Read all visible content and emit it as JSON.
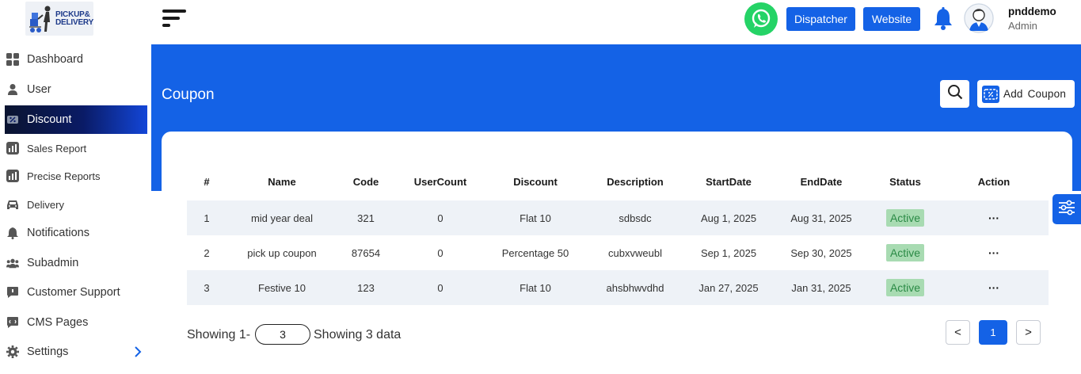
{
  "brand": {
    "logo_line1": "PICKUP&",
    "logo_line2": "DELIVERY"
  },
  "sidebar": {
    "items": [
      {
        "label": "Dashboard",
        "icon": "dashboard-grid-icon"
      },
      {
        "label": "User",
        "icon": "user-icon"
      },
      {
        "label": "Discount",
        "icon": "discount-ticket-icon",
        "active": true
      },
      {
        "label": "Sales Report",
        "icon": "chart-icon"
      },
      {
        "label": "Precise Reports",
        "icon": "chart-icon"
      },
      {
        "label": "Delivery",
        "icon": "car-icon"
      },
      {
        "label": "Notifications",
        "icon": "bell-icon"
      },
      {
        "label": "Subadmin",
        "icon": "group-icon"
      },
      {
        "label": "Customer Support",
        "icon": "chat-icon"
      },
      {
        "label": "CMS Pages",
        "icon": "chat-icon"
      },
      {
        "label": "Settings",
        "icon": "gear-icon",
        "has_submenu": true
      }
    ]
  },
  "topbar": {
    "dispatcher_label": "Dispatcher",
    "website_label": "Website",
    "user_name": "pnddemo",
    "user_role": "Admin"
  },
  "page": {
    "title": "Coupon",
    "add_label": "Add  Coupon"
  },
  "table": {
    "columns": [
      "#",
      "Name",
      "Code",
      "UserCount",
      "Discount",
      "Description",
      "StartDate",
      "EndDate",
      "Status",
      "Action"
    ],
    "rows": [
      {
        "num": "1",
        "name": "mid year deal",
        "code": "321",
        "user_count": "0",
        "discount": "Flat 10",
        "description": "sdbsdc",
        "start": "Aug 1, 2025",
        "end": "Aug 31, 2025",
        "status": "Active",
        "action": "···"
      },
      {
        "num": "2",
        "name": "pick up coupon",
        "code": "87654",
        "user_count": "0",
        "discount": "Percentage 50",
        "description": "cubxvweubl",
        "start": "Sep 1, 2025",
        "end": "Sep 30, 2025",
        "status": "Active",
        "action": "···"
      },
      {
        "num": "3",
        "name": "Festive 10",
        "code": "123",
        "user_count": "0",
        "discount": "Flat 10",
        "description": "ahsbhwvdhd",
        "start": "Jan 27, 2025",
        "end": "Jan 31, 2025",
        "status": "Active",
        "action": "···"
      }
    ]
  },
  "pagination": {
    "showing_prefix": "Showing 1-",
    "page_size": "3",
    "showing_suffix": "Showing 3 data",
    "prev": "<",
    "current": "1",
    "next": ">"
  },
  "colors": {
    "primary": "#1462e6",
    "active_badge_bg": "#a8dbb2",
    "active_badge_text": "#2a8a45",
    "whatsapp": "#25d366"
  }
}
